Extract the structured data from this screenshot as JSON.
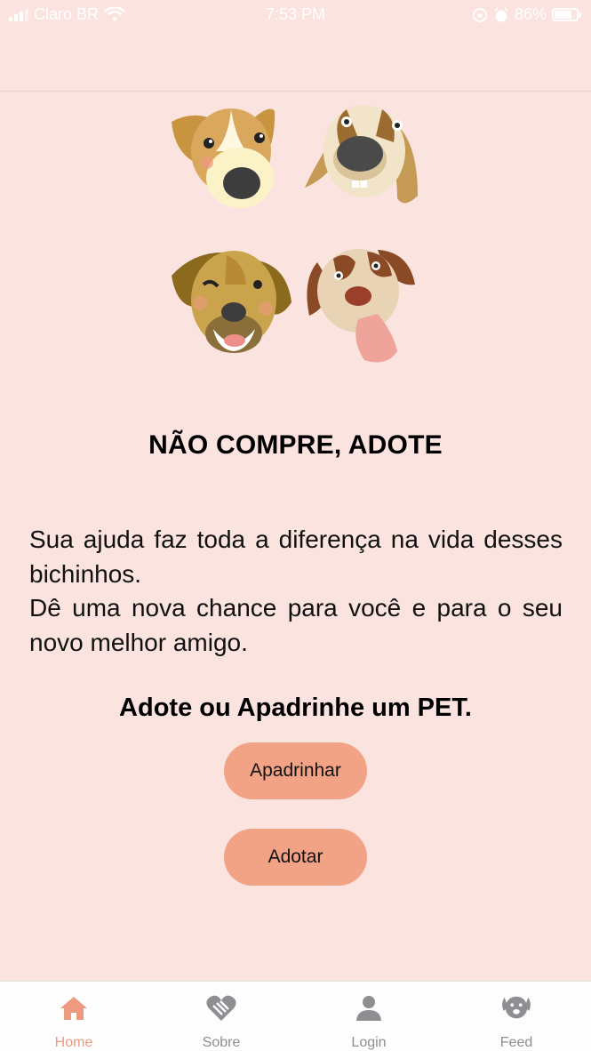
{
  "status_bar": {
    "carrier": "Claro BR",
    "time": "7:53 PM",
    "battery": "86%"
  },
  "hero": {
    "icon": "dog-faces-illustration"
  },
  "main": {
    "headline": "NÃO COMPRE, ADOTE",
    "paragraph_1": "Sua ajuda faz toda a diferença na vida desses bichinhos.",
    "paragraph_2": "Dê uma nova chance para você e para o seu novo melhor amigo.",
    "cta_title": "Adote ou Apadrinhe um PET.",
    "sponsor_label": "Apadrinhar",
    "adopt_label": "Adotar",
    "accent_color": "#f2a285",
    "background_color": "#fbe3df"
  },
  "tab_bar": {
    "tabs": [
      {
        "label": "Home",
        "icon": "home-icon",
        "active": true
      },
      {
        "label": "Sobre",
        "icon": "heart-hand-icon",
        "active": false
      },
      {
        "label": "Login",
        "icon": "user-icon",
        "active": false
      },
      {
        "label": "Feed",
        "icon": "dog-icon",
        "active": false
      }
    ]
  }
}
